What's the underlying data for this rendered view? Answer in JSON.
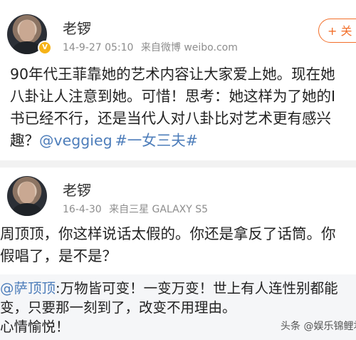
{
  "post1": {
    "username": "老锣",
    "date": "14-9-27 05:10",
    "source": "来自微博 weibo.com",
    "follow_label": "+ 关",
    "content_lines": [
      "90年代王菲靠她的艺术内容让大家爱上她。现在她",
      "八卦让人注意到她。可惜！思考：她这样为了她的I",
      "书已经不行，还是当代人对八卦比对艺术更有感兴"
    ],
    "last_line_prefix": "趣？",
    "mention": "@veggieg",
    "hashtag": "#一女三夫#"
  },
  "post2": {
    "username": "老锣",
    "date": "16-4-30",
    "source_prefix": "来自",
    "device": "三星 GALAXY S5",
    "content_lines": [
      "周顶顶，你这样说话太假的。你还是拿反了话筒。你",
      "假唱了，是不是？"
    ]
  },
  "repost": {
    "mention": "@萨顶顶",
    "line1_rest": ":万物皆可变！一变万变！世上有人连性别都能",
    "line2": "变，只要那一刻到了，改变不用理由。",
    "line3": "心情愉悦！"
  },
  "watermark": "头条 @娱乐锦鲤君"
}
